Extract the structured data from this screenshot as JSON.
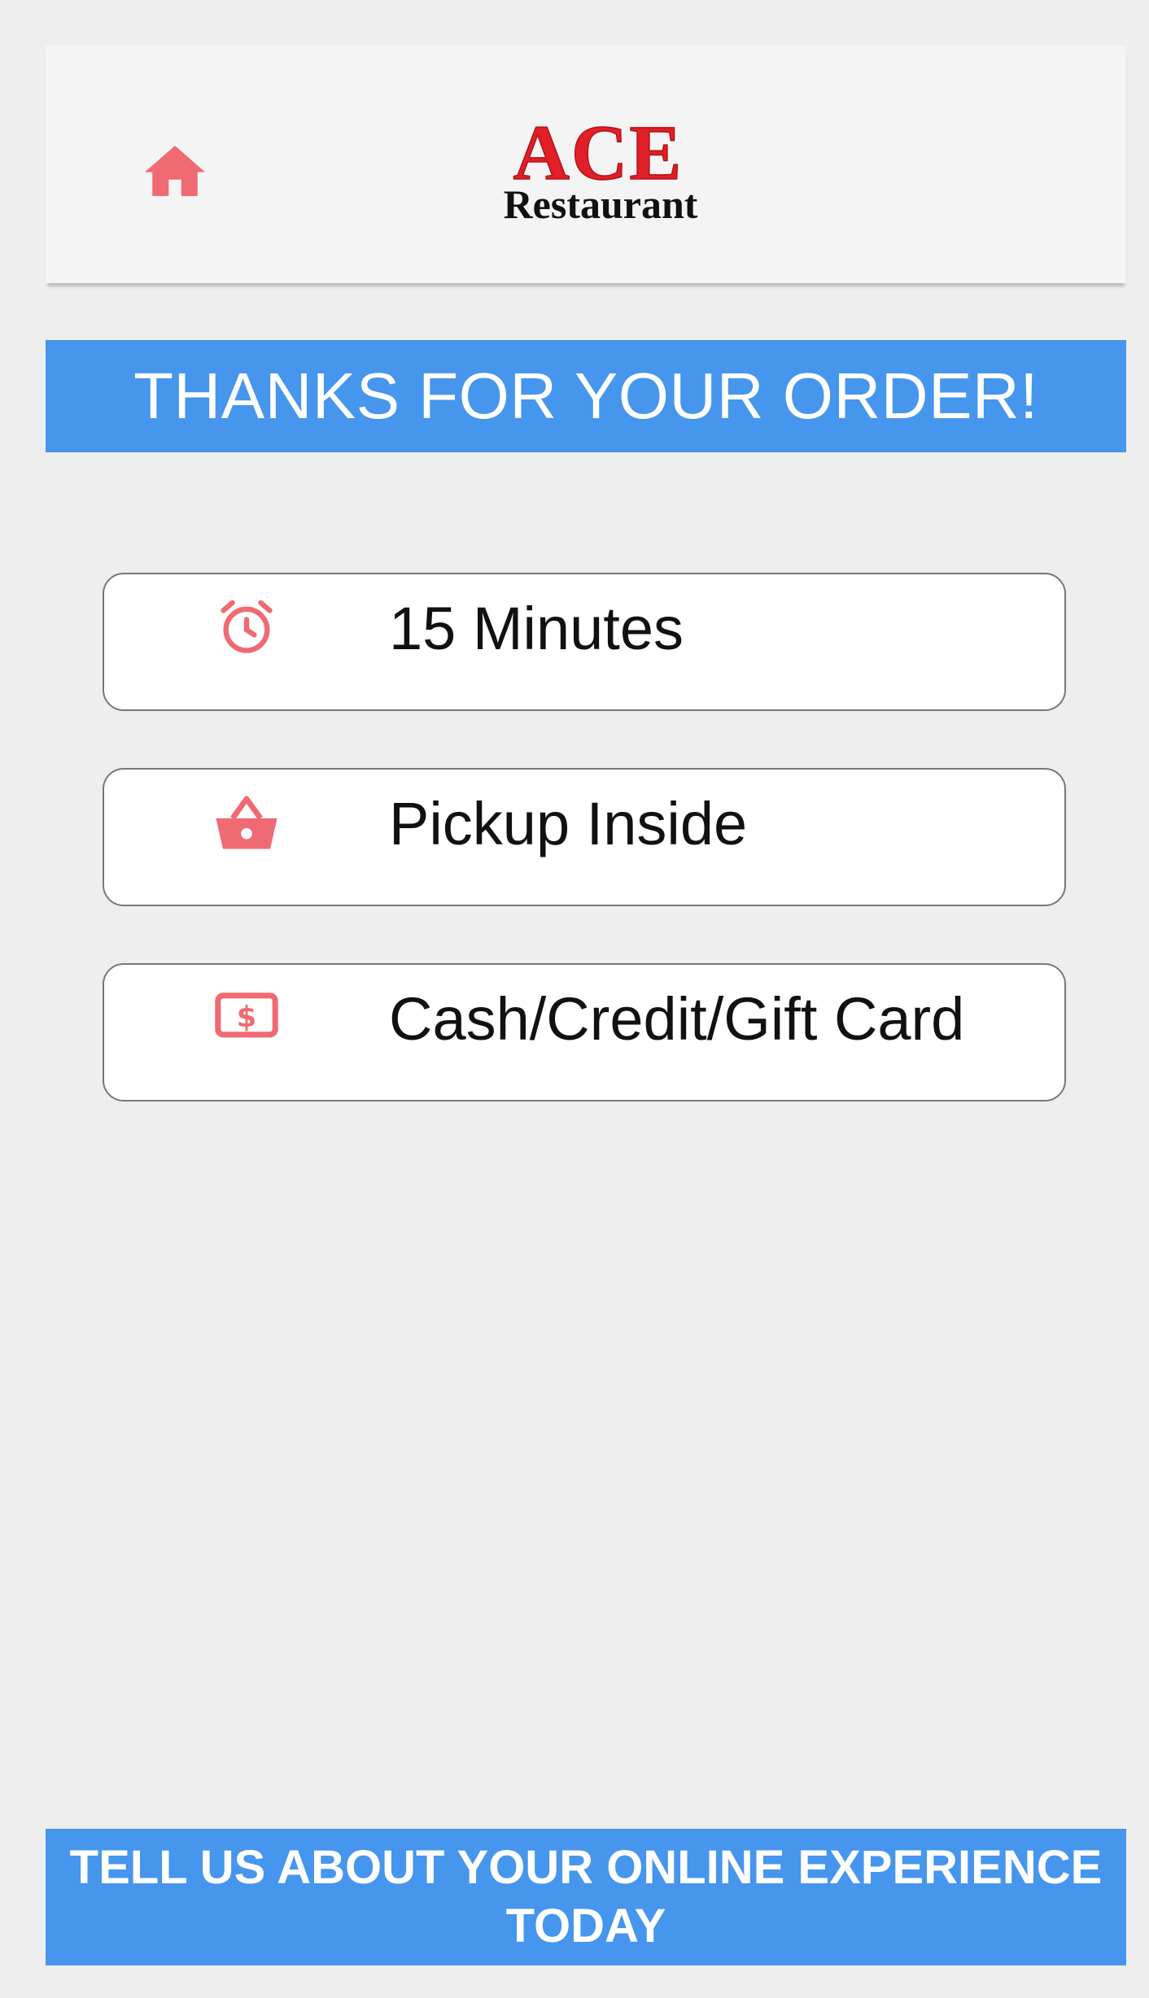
{
  "header": {
    "home_icon": "home-icon",
    "logo": {
      "brand": "ACE",
      "subtitle": "Restaurant",
      "brand_color": "#e01f26",
      "subtitle_color": "#111111"
    }
  },
  "banner": {
    "text": "THANKS FOR YOUR ORDER!",
    "color": "#4596ec"
  },
  "order_info": [
    {
      "icon": "alarm-clock-icon",
      "text": "15 Minutes"
    },
    {
      "icon": "shopping-basket-icon",
      "text": "Pickup Inside"
    },
    {
      "icon": "money-bill-icon",
      "text": "Cash/Credit/Gift Card"
    }
  ],
  "footer": {
    "feedback_label": "TELL US ABOUT YOUR ONLINE EXPERIENCE TODAY",
    "color": "#4596ec"
  },
  "colors": {
    "icon_accent": "#f06a73",
    "background": "#eeeeee"
  }
}
